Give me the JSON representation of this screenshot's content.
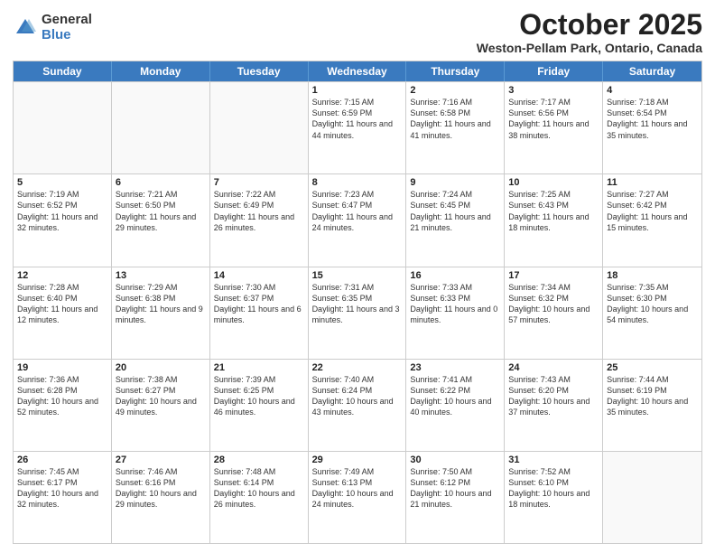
{
  "header": {
    "logo_general": "General",
    "logo_blue": "Blue",
    "month_title": "October 2025",
    "location": "Weston-Pellam Park, Ontario, Canada"
  },
  "weekdays": [
    "Sunday",
    "Monday",
    "Tuesday",
    "Wednesday",
    "Thursday",
    "Friday",
    "Saturday"
  ],
  "weeks": [
    [
      {
        "day": "",
        "info": ""
      },
      {
        "day": "",
        "info": ""
      },
      {
        "day": "",
        "info": ""
      },
      {
        "day": "1",
        "info": "Sunrise: 7:15 AM\nSunset: 6:59 PM\nDaylight: 11 hours\nand 44 minutes."
      },
      {
        "day": "2",
        "info": "Sunrise: 7:16 AM\nSunset: 6:58 PM\nDaylight: 11 hours\nand 41 minutes."
      },
      {
        "day": "3",
        "info": "Sunrise: 7:17 AM\nSunset: 6:56 PM\nDaylight: 11 hours\nand 38 minutes."
      },
      {
        "day": "4",
        "info": "Sunrise: 7:18 AM\nSunset: 6:54 PM\nDaylight: 11 hours\nand 35 minutes."
      }
    ],
    [
      {
        "day": "5",
        "info": "Sunrise: 7:19 AM\nSunset: 6:52 PM\nDaylight: 11 hours\nand 32 minutes."
      },
      {
        "day": "6",
        "info": "Sunrise: 7:21 AM\nSunset: 6:50 PM\nDaylight: 11 hours\nand 29 minutes."
      },
      {
        "day": "7",
        "info": "Sunrise: 7:22 AM\nSunset: 6:49 PM\nDaylight: 11 hours\nand 26 minutes."
      },
      {
        "day": "8",
        "info": "Sunrise: 7:23 AM\nSunset: 6:47 PM\nDaylight: 11 hours\nand 24 minutes."
      },
      {
        "day": "9",
        "info": "Sunrise: 7:24 AM\nSunset: 6:45 PM\nDaylight: 11 hours\nand 21 minutes."
      },
      {
        "day": "10",
        "info": "Sunrise: 7:25 AM\nSunset: 6:43 PM\nDaylight: 11 hours\nand 18 minutes."
      },
      {
        "day": "11",
        "info": "Sunrise: 7:27 AM\nSunset: 6:42 PM\nDaylight: 11 hours\nand 15 minutes."
      }
    ],
    [
      {
        "day": "12",
        "info": "Sunrise: 7:28 AM\nSunset: 6:40 PM\nDaylight: 11 hours\nand 12 minutes."
      },
      {
        "day": "13",
        "info": "Sunrise: 7:29 AM\nSunset: 6:38 PM\nDaylight: 11 hours\nand 9 minutes."
      },
      {
        "day": "14",
        "info": "Sunrise: 7:30 AM\nSunset: 6:37 PM\nDaylight: 11 hours\nand 6 minutes."
      },
      {
        "day": "15",
        "info": "Sunrise: 7:31 AM\nSunset: 6:35 PM\nDaylight: 11 hours\nand 3 minutes."
      },
      {
        "day": "16",
        "info": "Sunrise: 7:33 AM\nSunset: 6:33 PM\nDaylight: 11 hours\nand 0 minutes."
      },
      {
        "day": "17",
        "info": "Sunrise: 7:34 AM\nSunset: 6:32 PM\nDaylight: 10 hours\nand 57 minutes."
      },
      {
        "day": "18",
        "info": "Sunrise: 7:35 AM\nSunset: 6:30 PM\nDaylight: 10 hours\nand 54 minutes."
      }
    ],
    [
      {
        "day": "19",
        "info": "Sunrise: 7:36 AM\nSunset: 6:28 PM\nDaylight: 10 hours\nand 52 minutes."
      },
      {
        "day": "20",
        "info": "Sunrise: 7:38 AM\nSunset: 6:27 PM\nDaylight: 10 hours\nand 49 minutes."
      },
      {
        "day": "21",
        "info": "Sunrise: 7:39 AM\nSunset: 6:25 PM\nDaylight: 10 hours\nand 46 minutes."
      },
      {
        "day": "22",
        "info": "Sunrise: 7:40 AM\nSunset: 6:24 PM\nDaylight: 10 hours\nand 43 minutes."
      },
      {
        "day": "23",
        "info": "Sunrise: 7:41 AM\nSunset: 6:22 PM\nDaylight: 10 hours\nand 40 minutes."
      },
      {
        "day": "24",
        "info": "Sunrise: 7:43 AM\nSunset: 6:20 PM\nDaylight: 10 hours\nand 37 minutes."
      },
      {
        "day": "25",
        "info": "Sunrise: 7:44 AM\nSunset: 6:19 PM\nDaylight: 10 hours\nand 35 minutes."
      }
    ],
    [
      {
        "day": "26",
        "info": "Sunrise: 7:45 AM\nSunset: 6:17 PM\nDaylight: 10 hours\nand 32 minutes."
      },
      {
        "day": "27",
        "info": "Sunrise: 7:46 AM\nSunset: 6:16 PM\nDaylight: 10 hours\nand 29 minutes."
      },
      {
        "day": "28",
        "info": "Sunrise: 7:48 AM\nSunset: 6:14 PM\nDaylight: 10 hours\nand 26 minutes."
      },
      {
        "day": "29",
        "info": "Sunrise: 7:49 AM\nSunset: 6:13 PM\nDaylight: 10 hours\nand 24 minutes."
      },
      {
        "day": "30",
        "info": "Sunrise: 7:50 AM\nSunset: 6:12 PM\nDaylight: 10 hours\nand 21 minutes."
      },
      {
        "day": "31",
        "info": "Sunrise: 7:52 AM\nSunset: 6:10 PM\nDaylight: 10 hours\nand 18 minutes."
      },
      {
        "day": "",
        "info": ""
      }
    ]
  ]
}
